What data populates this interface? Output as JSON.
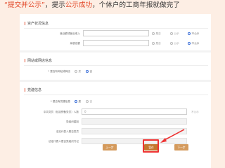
{
  "banner": {
    "quote_text": "“提交并公示”",
    "sep": "，提示",
    "success_text": "公示成功",
    "tail": "，个体户的工商年报就做完了"
  },
  "sections": {
    "assets_title": "资产状况信息",
    "website_title": "网站或网店信息",
    "guarantee_title": "党建信息"
  },
  "assets": {
    "row1_label": "营业额或营业收入",
    "row2_label": "纳税总额",
    "opt_yes": "是否",
    "opt_public": "公示",
    "opt_nonpublic": "不公示"
  },
  "website": {
    "question": "* 是否有网站或网店",
    "yes": "是",
    "no": "否"
  },
  "party": {
    "question": "* 是否有党建信息",
    "yes": "是",
    "no": "否",
    "row1_label": "中共党员（包括预备党员）人数",
    "row1_value": "0",
    "row1_tag": "不公示",
    "row2_label": "党组织建制",
    "row3_label": "法定代表人是否党员",
    "row4_label": "法定代表人是否党组织书记"
  },
  "buttons": {
    "prev": "上一步",
    "save": "暂存",
    "next": "下一步"
  },
  "colors": {
    "accent": "#e3492a",
    "radio_selected": "#3b6fd8",
    "button": "#d49a5c",
    "highlight": "#ee3333"
  }
}
